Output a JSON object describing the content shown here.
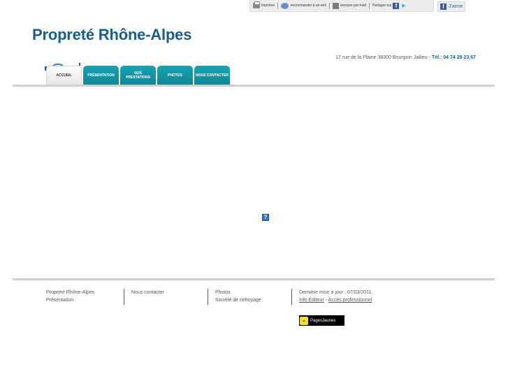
{
  "toolbar": {
    "print_label": "imprimer",
    "recommend_label": "recommander à un ami",
    "email_label": "envoyer par mail",
    "share_label": "Partager sur"
  },
  "like_button": {
    "label": "J'aime"
  },
  "site": {
    "title": "Propreté Rhône-Alpes"
  },
  "contact": {
    "address": "17 rue de la Plaine 38300 Bourgoin Jallieu",
    "separator": "-",
    "phone": "Tél.: 04 74 28 23 67"
  },
  "nav": {
    "tabs": [
      {
        "label": "ACCUEIL"
      },
      {
        "label": "PRÉSENTATION"
      },
      {
        "label": "NOS PRESTATIONS"
      },
      {
        "label": "PHOTOS"
      },
      {
        "label": "NOUS CONTACTER"
      }
    ]
  },
  "footer": {
    "col1": [
      "Propreté Rhône-Alpes",
      "Présentation"
    ],
    "col2": [
      "Nous contacter"
    ],
    "col3": [
      "Photos",
      "Société de nettoyage"
    ],
    "last_update": "Dernière mise à jour : 07/03/2011",
    "info_editeur": "Info Éditeur",
    "dash": " - ",
    "acces_pro": "Accès professionnel"
  },
  "badge": {
    "label": "PagesJaunes"
  },
  "colors": {
    "title": "#1a5c8e",
    "tab": "#1aa3b3",
    "divider": "#cfcfcf"
  },
  "icons": [
    "printer-icon",
    "recommend-icon",
    "email-icon",
    "facebook-icon",
    "twitter-icon",
    "broken-image-icon",
    "pagesjaunes-logo"
  ]
}
